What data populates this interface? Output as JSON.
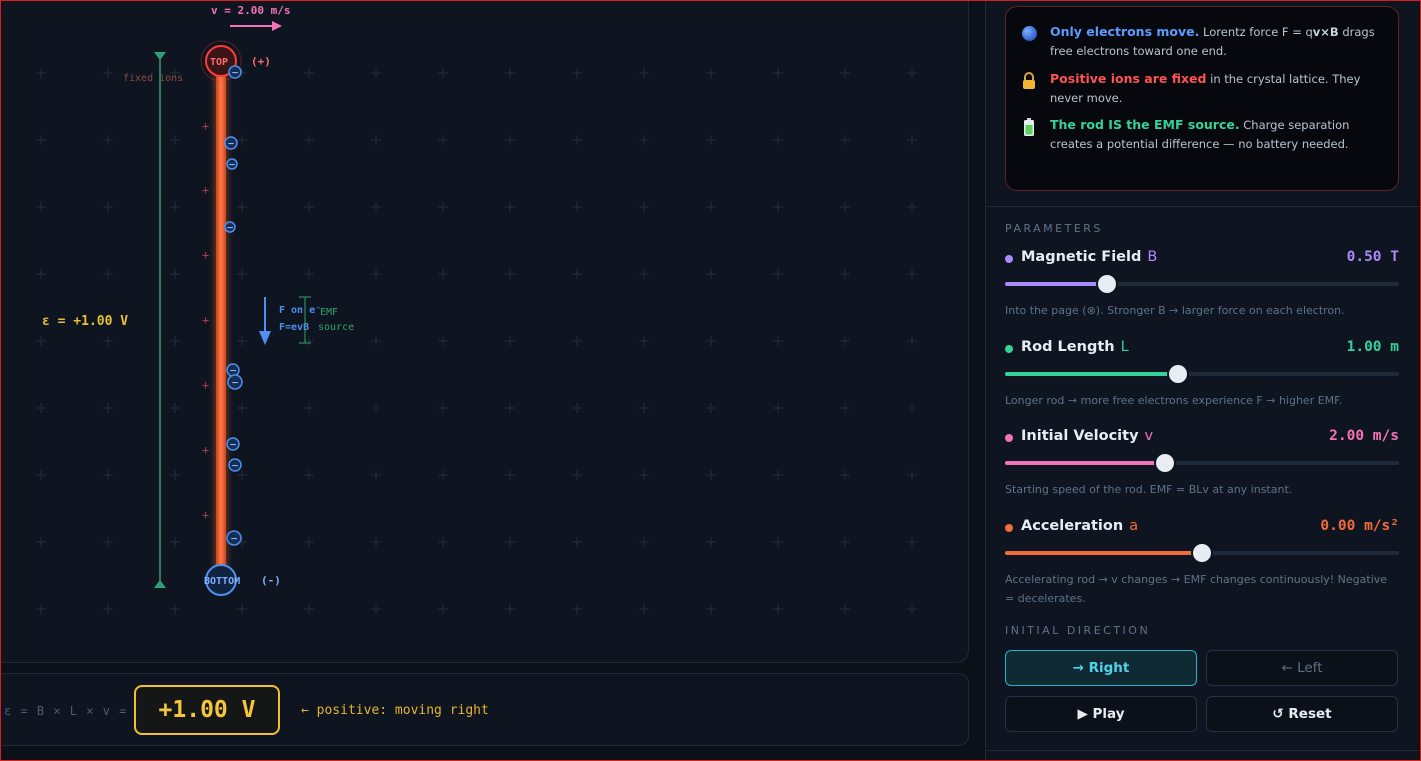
{
  "simulation": {
    "velocity_label": "v = 2.00 m/s",
    "top_label": "TOP (+)",
    "top_short": "TOP",
    "top_sign": "(+)",
    "bottom_label": "BOTTOM (-)",
    "bottom_short": "BOTTOM",
    "bottom_sign": "(-)",
    "fixed_ions_label": "fixed ions",
    "emf_label": "ε = +1.00 V",
    "force_label_1": "F on e⁻",
    "force_label_2": "F=evB",
    "emf_source_label_1": "EMF",
    "emf_source_label_2": "source",
    "ion_sign": "+",
    "electron_sign": "−"
  },
  "emf_bar": {
    "formula": "ε = B × L × v =",
    "value": "+1.00 V",
    "note": "← positive: moving right"
  },
  "info": {
    "row1_title": "Only electrons move.",
    "row1_text": " Lorentz force F = q",
    "row1_bold": "v×B",
    "row1_text2": " drags free electrons toward one end.",
    "row2_title": "Positive ions are fixed",
    "row2_text": " in the crystal lattice. They never move.",
    "row3_title": "The rod IS the EMF source.",
    "row3_text": " Charge separation creates a potential difference — no battery needed.",
    "row1_icon": "electron-ball-icon",
    "row2_icon": "lock-icon",
    "row3_icon": "battery-icon"
  },
  "parameters": {
    "section_label": "PARAMETERS",
    "items": [
      {
        "name": "Magnetic Field",
        "symbol": "B",
        "value": "0.50 T",
        "fraction": 0.26,
        "color": "#a78bfa",
        "desc": "Into the page (⊗). Stronger B → larger force on each electron."
      },
      {
        "name": "Rod Length",
        "symbol": "L",
        "value": "1.00 m",
        "fraction": 0.44,
        "color": "#34d399",
        "desc": "Longer rod → more free electrons experience F → higher EMF."
      },
      {
        "name": "Initial Velocity",
        "symbol": "v",
        "value": "2.00 m/s",
        "fraction": 0.405,
        "color": "#f472b6",
        "desc": "Starting speed of the rod. EMF = BLv at any instant."
      },
      {
        "name": "Acceleration",
        "symbol": "a",
        "value": "0.00 m/s²",
        "fraction": 0.5,
        "color": "#f26b3a",
        "desc": "Accelerating rod → v changes → EMF changes continuously! Negative = decelerates."
      }
    ]
  },
  "direction": {
    "section_label": "INITIAL DIRECTION",
    "right_label": "→ Right",
    "left_label": "← Left",
    "play_label": "▶ Play",
    "reset_label": "↺ Reset"
  },
  "colors": {
    "accent": "#2ab0c9",
    "rod": "#f26b3a",
    "positive": "#ff4d4d",
    "negative": "#4f8ff0",
    "emf": "#f6c63a",
    "green": "#2fa36b"
  }
}
